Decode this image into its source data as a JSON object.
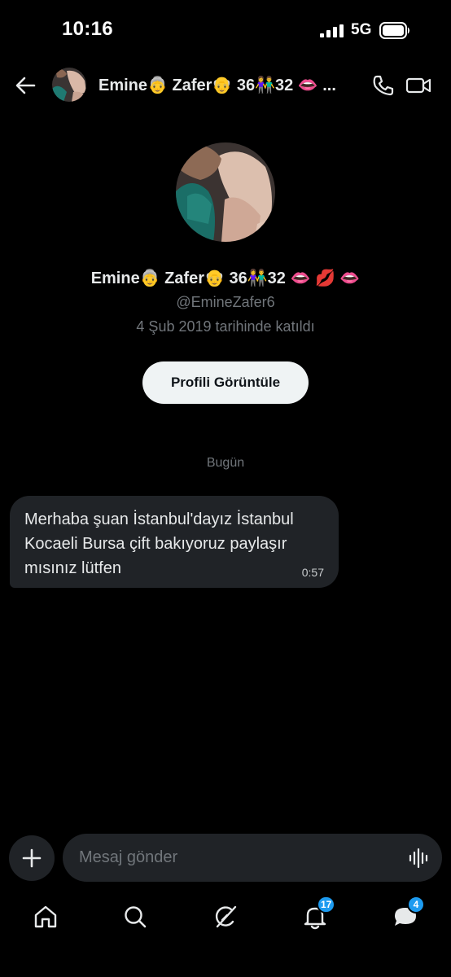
{
  "status_bar": {
    "time": "10:16",
    "network": "5G"
  },
  "header": {
    "name": "Emine👵 Zafer👴 36👫32 👄 ...",
    "icons": [
      "back-arrow-icon",
      "phone-icon",
      "video-icon"
    ]
  },
  "profile": {
    "display_name": "Emine👵 Zafer👴 36👫32 👄 💋 👄",
    "handle": "@EmineZafer6",
    "joined": "4 Şub 2019 tarihinde katıldı",
    "view_button": "Profili Görüntüle"
  },
  "conversation": {
    "day_label": "Bugün",
    "messages": [
      {
        "text": "Merhaba şuan İstanbul'dayız İstanbul Kocaeli Bursa çift bakıyoruz paylaşır mısınız lütfen",
        "time": "0:57"
      }
    ]
  },
  "composer": {
    "placeholder": "Mesaj gönder"
  },
  "bottom_nav": {
    "items": [
      {
        "name": "home",
        "icon": "home-icon"
      },
      {
        "name": "search",
        "icon": "search-icon"
      },
      {
        "name": "grok",
        "icon": "grok-icon"
      },
      {
        "name": "notifications",
        "icon": "bell-icon",
        "badge": "17"
      },
      {
        "name": "messages",
        "icon": "messages-icon",
        "badge": "4"
      }
    ]
  },
  "colors": {
    "background": "#000000",
    "bubble": "#202327",
    "accent": "#1d9bf0",
    "muted": "#71767b"
  }
}
